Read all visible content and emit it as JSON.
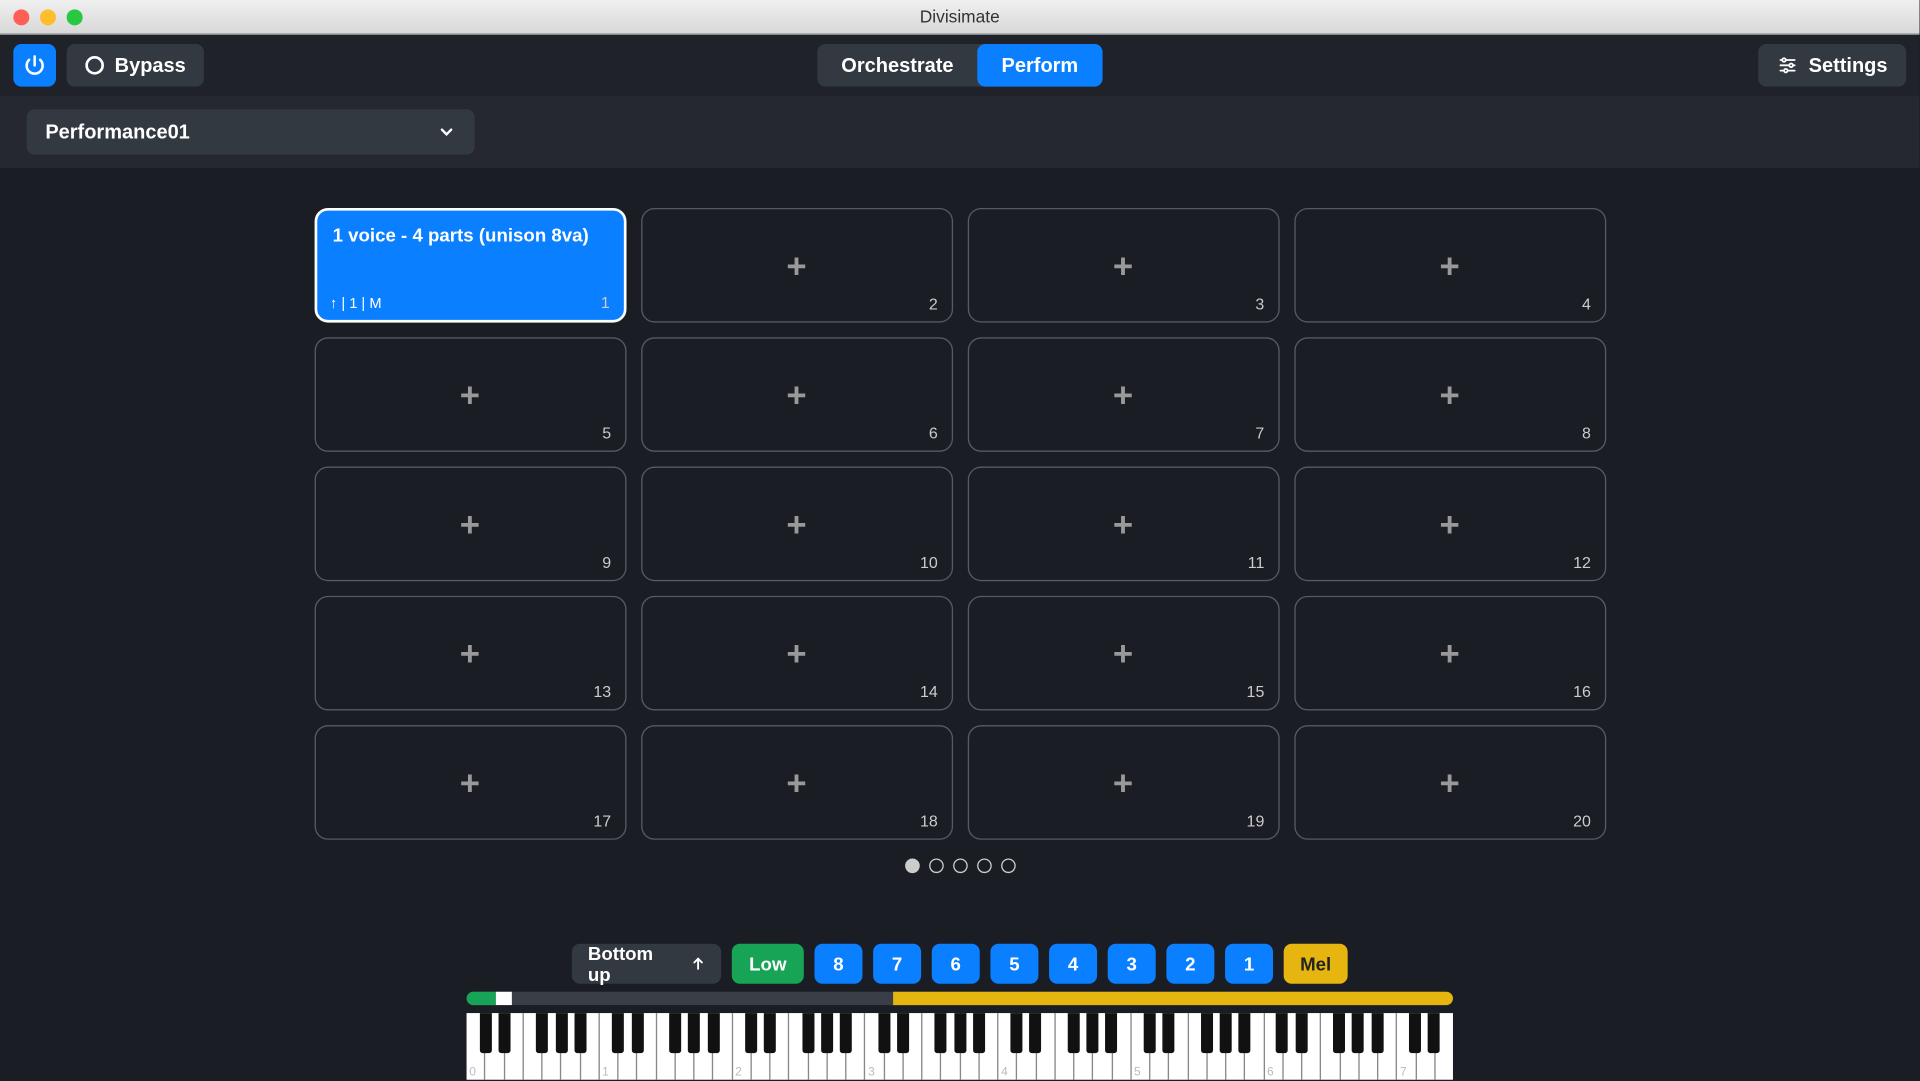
{
  "window": {
    "title": "Divisimate"
  },
  "header": {
    "bypass_label": "Bypass",
    "modes": {
      "orchestrate": "Orchestrate",
      "perform": "Perform",
      "active": "perform"
    },
    "settings_label": "Settings"
  },
  "performance": {
    "name": "Performance01"
  },
  "slots": [
    {
      "n": 1,
      "active": true,
      "title": "1 voice - 4 parts (unison 8va)",
      "meta": "↑ | 1 | M"
    },
    {
      "n": 2,
      "active": false
    },
    {
      "n": 3,
      "active": false
    },
    {
      "n": 4,
      "active": false
    },
    {
      "n": 5,
      "active": false
    },
    {
      "n": 6,
      "active": false
    },
    {
      "n": 7,
      "active": false
    },
    {
      "n": 8,
      "active": false
    },
    {
      "n": 9,
      "active": false
    },
    {
      "n": 10,
      "active": false
    },
    {
      "n": 11,
      "active": false
    },
    {
      "n": 12,
      "active": false
    },
    {
      "n": 13,
      "active": false
    },
    {
      "n": 14,
      "active": false
    },
    {
      "n": 15,
      "active": false
    },
    {
      "n": 16,
      "active": false
    },
    {
      "n": 17,
      "active": false
    },
    {
      "n": 18,
      "active": false
    },
    {
      "n": 19,
      "active": false
    },
    {
      "n": 20,
      "active": false
    }
  ],
  "pager": {
    "pages": 5,
    "current": 0
  },
  "bottom": {
    "direction_label": "Bottom up",
    "low_label": "Low",
    "numbers": [
      "8",
      "7",
      "6",
      "5",
      "4",
      "3",
      "2",
      "1"
    ],
    "mel_label": "Mel"
  },
  "keyboard": {
    "octaves": 7,
    "start_octave": 0,
    "labels": [
      "0",
      "1",
      "2",
      "3",
      "4",
      "5",
      "6",
      "7"
    ]
  }
}
